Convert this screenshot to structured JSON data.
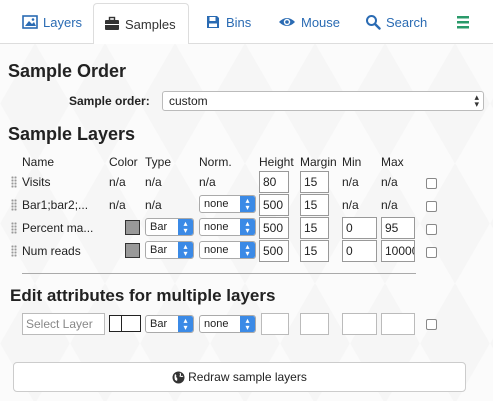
{
  "tabs": [
    {
      "label": "Layers",
      "icon": "image-icon"
    },
    {
      "label": "Samples",
      "icon": "briefcase-icon"
    },
    {
      "label": "Bins",
      "icon": "save-icon"
    },
    {
      "label": "Mouse",
      "icon": "eye-icon"
    },
    {
      "label": "Search",
      "icon": "search-icon"
    }
  ],
  "active_tab": "Samples",
  "menu_icon": "hamburger-icon",
  "accent_color": "#2a6bb3",
  "sample_order": {
    "heading": "Sample Order",
    "label": "Sample order:",
    "value": "custom"
  },
  "sample_layers": {
    "heading": "Sample Layers",
    "columns": [
      "Name",
      "Color",
      "Type",
      "Norm.",
      "Height",
      "Margin",
      "Min",
      "Max"
    ],
    "rows": [
      {
        "name": "Visits",
        "color": "n/a",
        "type": "n/a",
        "norm": "n/a",
        "height": "80",
        "margin": "15",
        "min": "n/a",
        "max": "n/a"
      },
      {
        "name": "Bar1;bar2;...",
        "color": "n/a",
        "type": "n/a",
        "norm": "none",
        "height": "500",
        "margin": "15",
        "min": "n/a",
        "max": "n/a"
      },
      {
        "name": "Percent ma...",
        "color": "#999999",
        "type": "Bar",
        "norm": "none",
        "height": "500",
        "margin": "15",
        "min": "0",
        "max": "95"
      },
      {
        "name": "Num reads",
        "color": "#999999",
        "type": "Bar",
        "norm": "none",
        "height": "500",
        "margin": "15",
        "min": "0",
        "max": "10000"
      }
    ]
  },
  "multi_edit": {
    "heading": "Edit attributes for multiple layers",
    "select_placeholder": "Select Layer",
    "type": "Bar",
    "norm": "none"
  },
  "redraw_button": {
    "label": "Redraw sample layers",
    "icon": "globe-icon"
  }
}
